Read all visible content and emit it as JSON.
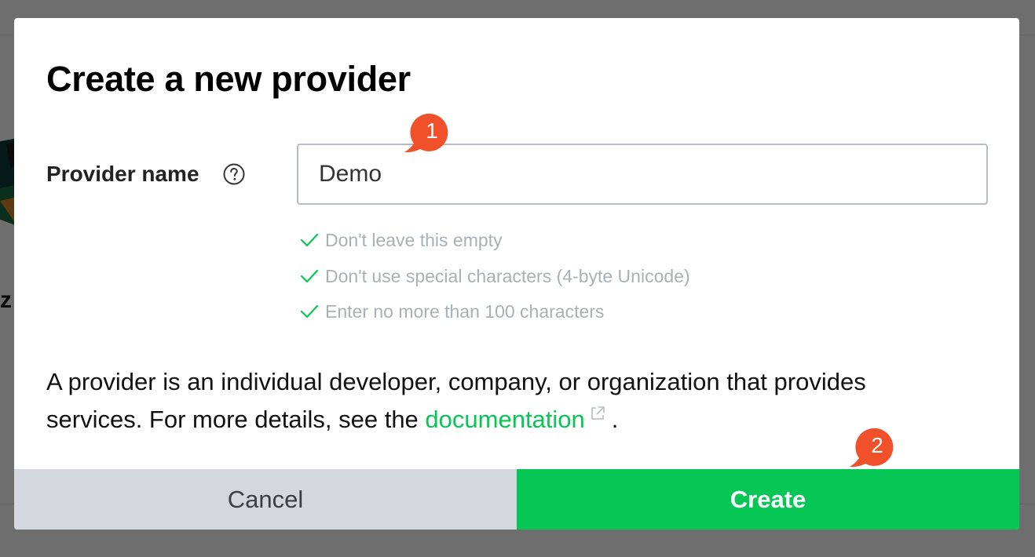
{
  "dialog": {
    "title": "Create a new provider",
    "field_label": "Provider name",
    "input_value": "Demo",
    "rules": [
      "Don't leave this empty",
      "Don't use special characters (4-byte Unicode)",
      "Enter no more than 100 characters"
    ],
    "description_pre": "A provider is an individual developer, company, or organization that provides services. For more details, see the ",
    "description_link": "documentation",
    "description_post": ".",
    "cancel_label": "Cancel",
    "create_label": "Create"
  },
  "annotations": {
    "step1": "1",
    "step2": "2"
  },
  "background": {
    "partial_letter": "z"
  },
  "colors": {
    "accent_green": "#06c755",
    "cancel_gray": "#d3d7de",
    "badge_red": "#f0502a",
    "rule_text": "#aab0b8"
  },
  "icons": {
    "help": "question-circle-icon",
    "rule_ok": "check-icon",
    "external": "external-link-icon"
  }
}
